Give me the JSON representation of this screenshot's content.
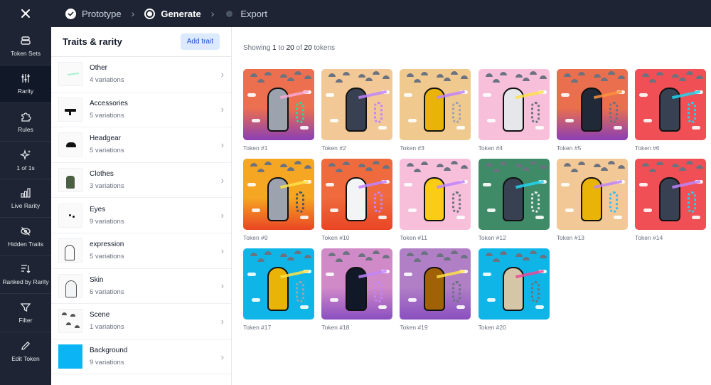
{
  "steps": [
    {
      "label": "Prototype",
      "state": "done"
    },
    {
      "label": "Generate",
      "state": "active"
    },
    {
      "label": "Export",
      "state": "todo"
    }
  ],
  "rail": [
    {
      "label": "Token Sets",
      "icon": "stack-icon"
    },
    {
      "label": "Rarity",
      "icon": "sliders-icon",
      "active": true
    },
    {
      "label": "Rules",
      "icon": "puzzle-icon"
    },
    {
      "label": "1 of 1s",
      "icon": "sparkle-icon"
    },
    {
      "label": "Live Rarity",
      "icon": "bar-chart-icon"
    },
    {
      "label": "Hidden Traits",
      "icon": "eye-off-icon"
    },
    {
      "label": "Ranked by Rarity",
      "icon": "sort-icon"
    },
    {
      "label": "Filter",
      "icon": "filter-icon"
    },
    {
      "label": "Edit Token",
      "icon": "pencil-icon"
    }
  ],
  "traits": {
    "title": "Traits & rarity",
    "add_label": "Add trait",
    "items": [
      {
        "name": "Other",
        "variations": "4 variations"
      },
      {
        "name": "Accessories",
        "variations": "5 variations"
      },
      {
        "name": "Headgear",
        "variations": "5 variations"
      },
      {
        "name": "Clothes",
        "variations": "3 variations"
      },
      {
        "name": "Eyes",
        "variations": "9 variations"
      },
      {
        "name": "expression",
        "variations": "5 variations"
      },
      {
        "name": "Skin",
        "variations": "6 variations"
      },
      {
        "name": "Scene",
        "variations": "1 variations"
      },
      {
        "name": "Background",
        "variations": "9 variations"
      }
    ]
  },
  "showing": {
    "prefix": "Showing",
    "from": "1",
    "to_word": "to",
    "to": "20",
    "of_word": "of",
    "total": "20",
    "suffix": "tokens"
  },
  "tokens": [
    {
      "label": "Token #1",
      "bg": "#ec6f4f",
      "bg2": "#8a3fb5",
      "skin": "#9ca3af",
      "beam": "#f9a8d4",
      "coil": "#34d399"
    },
    {
      "label": "Token #2",
      "bg": "#f2c996",
      "bg2": "#f2c996",
      "skin": "#374151",
      "beam": "#c084fc",
      "coil": "#c084fc"
    },
    {
      "label": "Token #3",
      "bg": "#f0c98f",
      "bg2": "#f0c98f",
      "skin": "#eab308",
      "beam": "#c084fc",
      "coil": "#9ca3af"
    },
    {
      "label": "Token #4",
      "bg": "#f8bfdb",
      "bg2": "#f8bfdb",
      "skin": "#e5e7eb",
      "beam": "#fde047",
      "coil": "#6b7280"
    },
    {
      "label": "Token #5",
      "bg": "#ea6f4f",
      "bg2": "#8a3fb5",
      "skin": "#1f2937",
      "beam": "#fb923c",
      "coil": "#6b7280"
    },
    {
      "label": "Token #6",
      "bg": "#f04f55",
      "bg2": "#f04f55",
      "skin": "#374151",
      "beam": "#22d3ee",
      "coil": "#22d3ee"
    },
    {
      "label": "Token #9",
      "bg": "#f5a623",
      "bg2": "#e94524",
      "skin": "#9ca3af",
      "beam": "#fde047",
      "coil": "#4b5563"
    },
    {
      "label": "Token #10",
      "bg": "#ef6a3d",
      "bg2": "#e94524",
      "skin": "#f3f4f6",
      "beam": "#c084fc",
      "coil": "#c084fc"
    },
    {
      "label": "Token #11",
      "bg": "#f8bfdb",
      "bg2": "#f8bfdb",
      "skin": "#facc15",
      "beam": "#c084fc",
      "coil": "#6b7280"
    },
    {
      "label": "Token #12",
      "bg": "#3f8b68",
      "bg2": "#3f8b68",
      "skin": "#374151",
      "beam": "#22d3ee",
      "coil": "#e5e7eb"
    },
    {
      "label": "Token #13",
      "bg": "#f2c996",
      "bg2": "#f2c996",
      "skin": "#eab308",
      "beam": "#c084fc",
      "coil": "#38bdf8"
    },
    {
      "label": "Token #14",
      "bg": "#f04f55",
      "bg2": "#f04f55",
      "skin": "#374151",
      "beam": "#c084fc",
      "coil": "#22d3ee"
    },
    {
      "label": "Token #17",
      "bg": "#10b5e8",
      "bg2": "#10b5e8",
      "skin": "#eab308",
      "beam": "#fde047",
      "coil": "#9ca3af"
    },
    {
      "label": "Token #18",
      "bg": "#d18ac8",
      "bg2": "#8a4fc0",
      "skin": "#111827",
      "beam": "#c084fc",
      "coil": "#c084fc"
    },
    {
      "label": "Token #19",
      "bg": "#b07fc6",
      "bg2": "#8a4fc0",
      "skin": "#a16207",
      "beam": "#fde047",
      "coil": "#6b7280"
    },
    {
      "label": "Token #20",
      "bg": "#10b5e8",
      "bg2": "#10b5e8",
      "skin": "#d6c6a8",
      "beam": "#ec4899",
      "coil": "#6b7280"
    }
  ]
}
